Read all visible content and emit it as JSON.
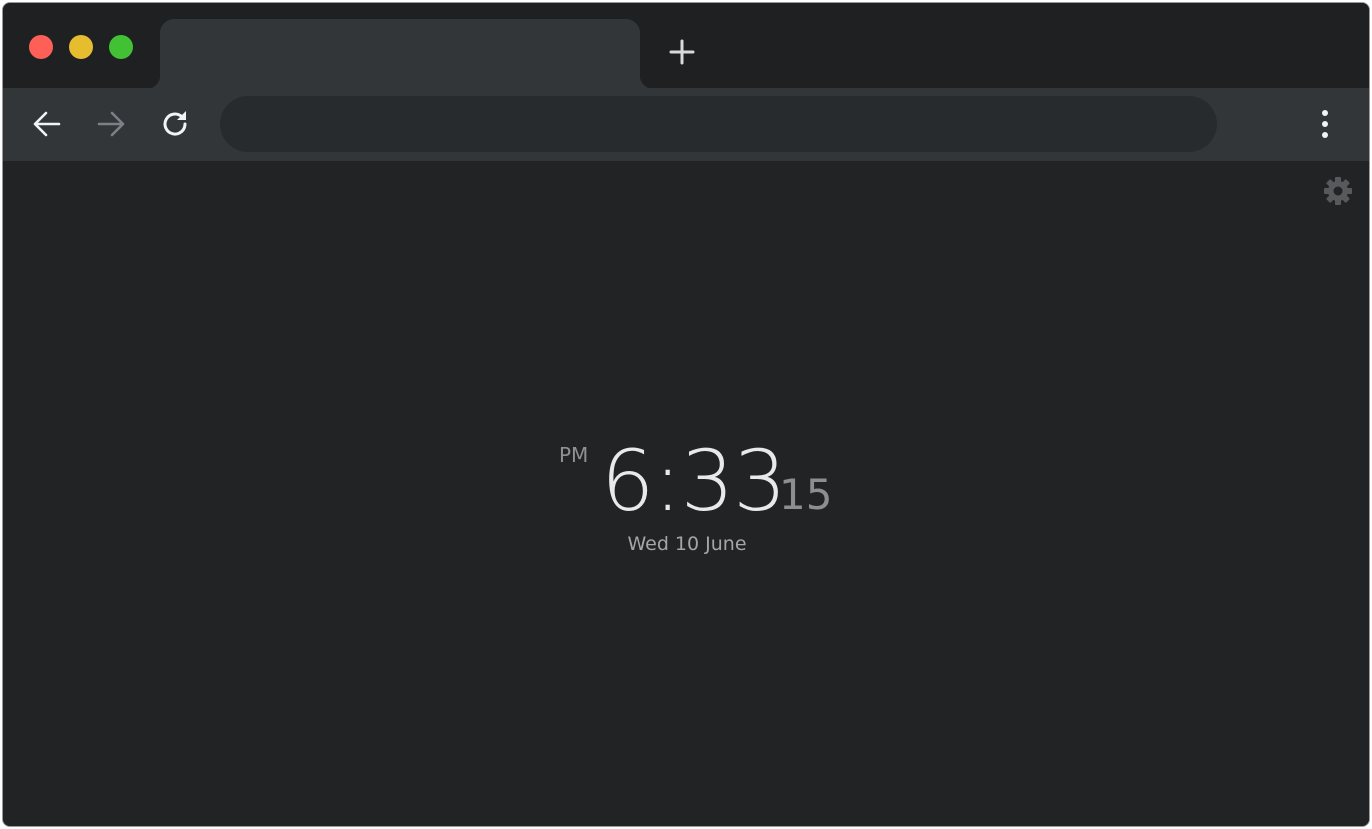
{
  "browser": {
    "tab": {
      "title": ""
    },
    "new_tab_icon": "plus-icon",
    "address_bar": {
      "value": "",
      "placeholder": ""
    },
    "nav_icons": [
      "arrow-left-icon",
      "arrow-right-icon",
      "reload-icon"
    ],
    "menu_icon": "kebab-menu-icon"
  },
  "page": {
    "settings_icon": "gear-icon",
    "clock": {
      "period": "PM",
      "time": "6:33",
      "seconds": "15",
      "date": "Wed 10 June"
    }
  },
  "colors": {
    "background": "#222325",
    "toolbar": "#323638",
    "titlebar": "#1f2022",
    "traffic_close": "#fe5f57",
    "traffic_minimize": "#e6bd2f",
    "traffic_maximize": "#43c134"
  }
}
